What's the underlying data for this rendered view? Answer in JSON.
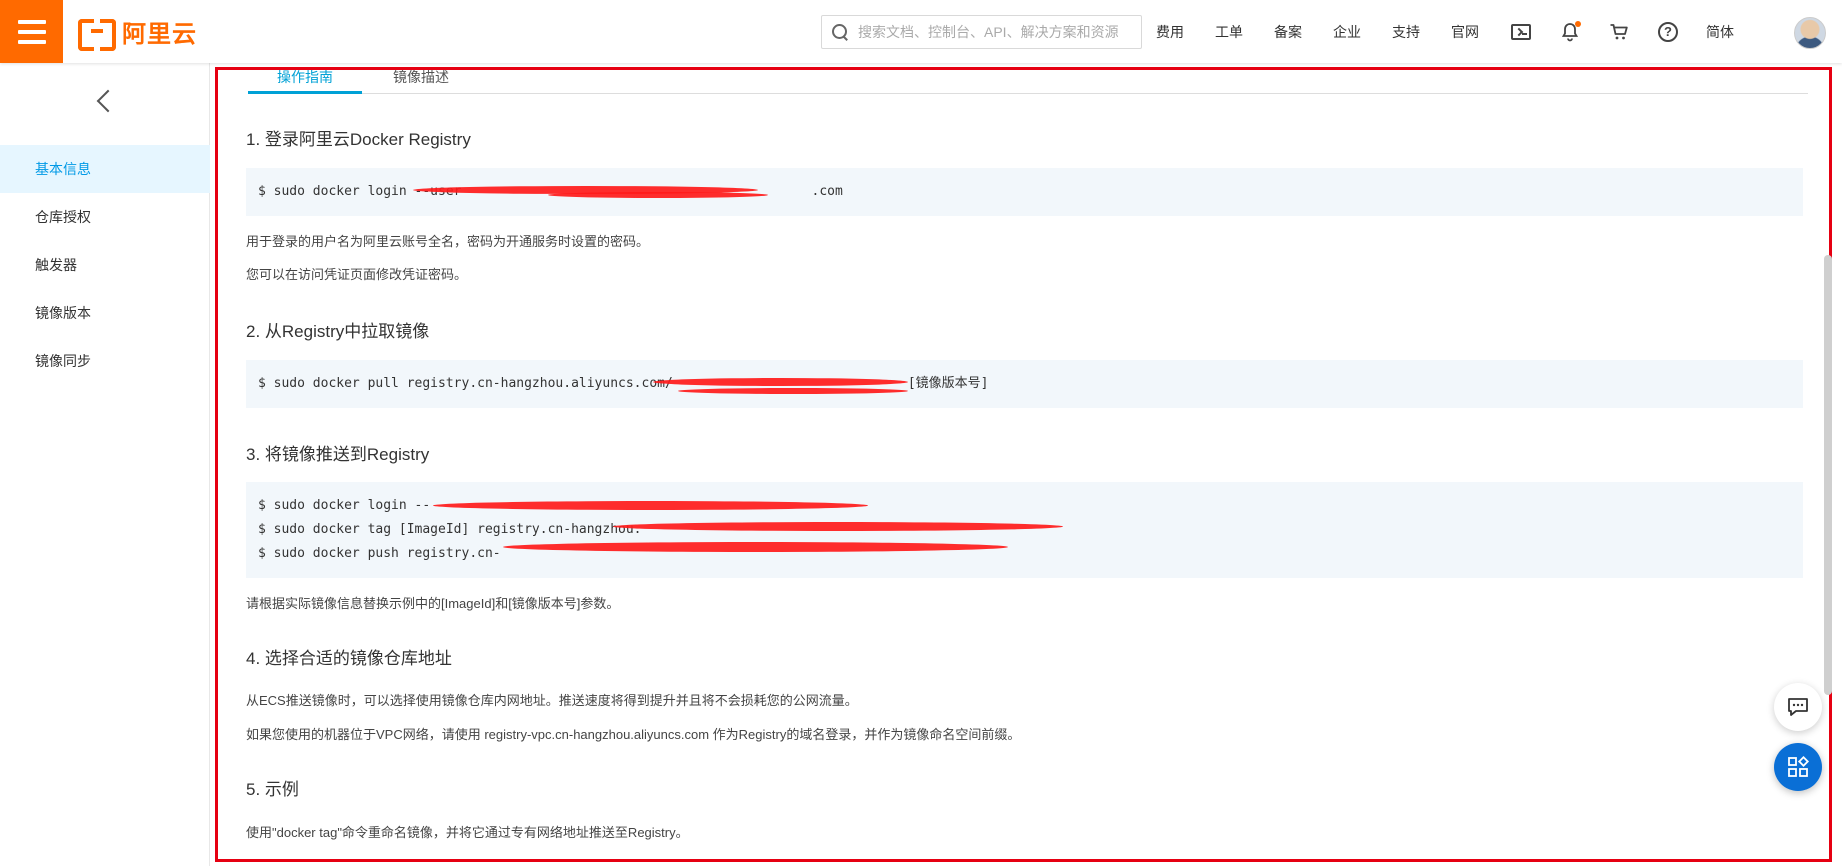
{
  "header": {
    "logo_text": "阿里云",
    "search_placeholder": "搜索文档、控制台、API、解决方案和资源",
    "nav_links": [
      "费用",
      "工单",
      "备案",
      "企业",
      "支持",
      "官网"
    ],
    "language": "简体",
    "icons": [
      "menu-icon",
      "search-icon",
      "terminal-icon",
      "bell-icon",
      "cart-icon",
      "help-icon",
      "avatar"
    ],
    "brand_color": "#ff6a00"
  },
  "sidebar": {
    "items": [
      {
        "label": "基本信息",
        "active": true
      },
      {
        "label": "仓库授权",
        "active": false
      },
      {
        "label": "触发器",
        "active": false
      },
      {
        "label": "镜像版本",
        "active": false
      },
      {
        "label": "镜像同步",
        "active": false
      }
    ],
    "active_color": "#0099e6"
  },
  "content": {
    "tabs": [
      {
        "label": "操作指南",
        "active": true
      },
      {
        "label": "镜像描述",
        "active": false
      }
    ],
    "sections": {
      "s1_title": "1. 登录阿里云Docker Registry",
      "s1_code": [
        "$ sudo docker login --user",
        ".com"
      ],
      "s1_note1": "用于登录的用户名为阿里云账号全名，密码为开通服务时设置的密码。",
      "s1_note2": "您可以在访问凭证页面修改凭证密码。",
      "s2_title": "2. 从Registry中拉取镜像",
      "s2_code": [
        "$ sudo docker pull registry.cn-hangzhou.aliyuncs.com/",
        "[镜像版本号]"
      ],
      "s3_title": "3. 将镜像推送到Registry",
      "s3_code": [
        "$ sudo docker login --",
        "$ sudo docker tag [ImageId] registry.cn-hangzhou.",
        "$ sudo docker push registry.cn-"
      ],
      "s3_note": "请根据实际镜像信息替换示例中的[ImageId]和[镜像版本号]参数。",
      "s4_title": "4. 选择合适的镜像仓库地址",
      "s4_note1": "从ECS推送镜像时，可以选择使用镜像仓库内网地址。推送速度将得到提升并且将不会损耗您的公网流量。",
      "s4_note2": "如果您使用的机器位于VPC网络，请使用 registry-vpc.cn-hangzhou.aliyuncs.com 作为Registry的域名登录，并作为镜像命名空间前缀。",
      "s5_title": "5. 示例",
      "s5_note": "使用\"docker tag\"命令重命名镜像，并将它通过专有网络地址推送至Registry。"
    },
    "highlight_border_color": "#e60012",
    "redaction_color": "#ff1a1a"
  },
  "floating": {
    "chat_icon": "chat-icon",
    "apps_icon": "apps-icon"
  }
}
